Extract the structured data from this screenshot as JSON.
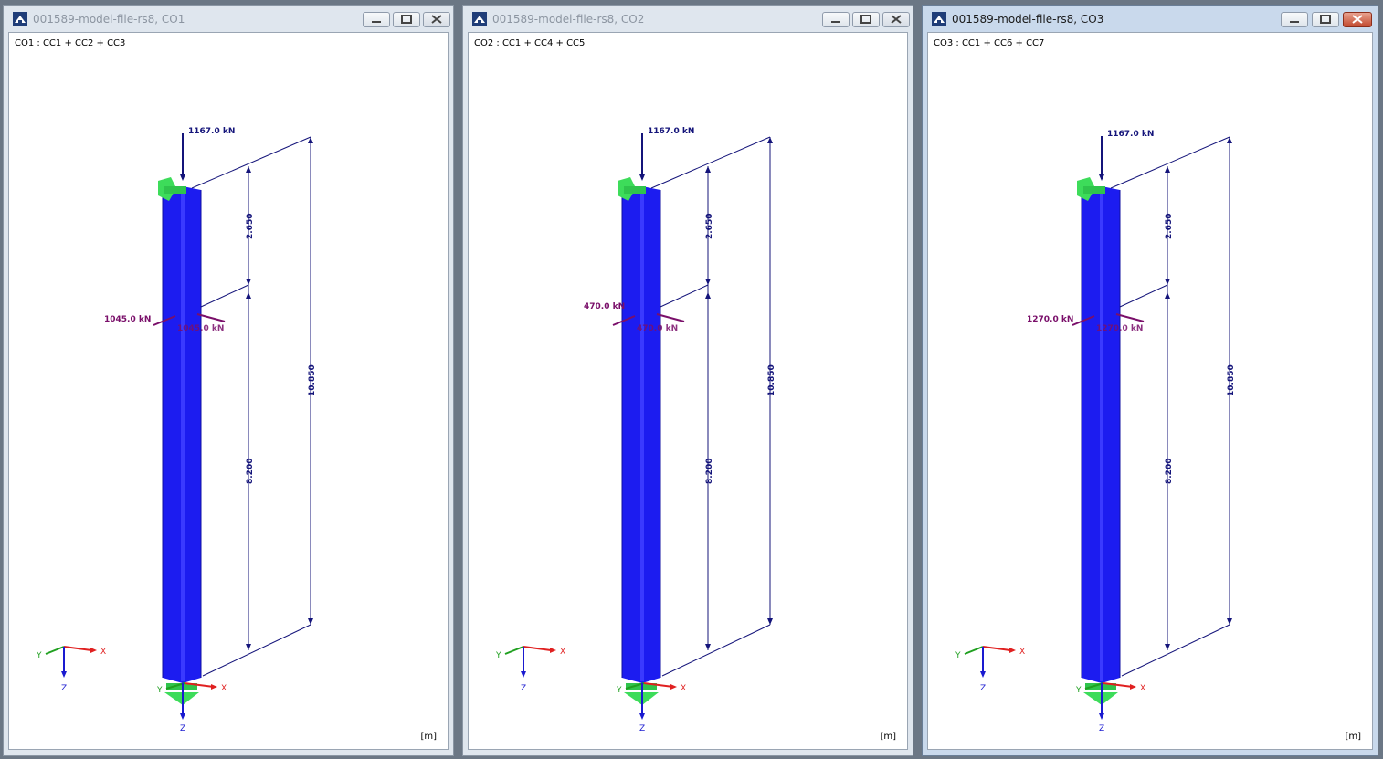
{
  "windows": [
    {
      "title": "001589-model-file-rs8, CO1",
      "active": false,
      "combination": "CO1 : CC1 + CC2 + CC3",
      "top_load": "1167.0 kN",
      "side_load_left": "1045.0 kN",
      "side_load_right": "1045.0 kN",
      "dim_upper": "2.650",
      "dim_lower": "8.200",
      "dim_total": "10.850",
      "units": "[m]"
    },
    {
      "title": "001589-model-file-rs8, CO2",
      "active": false,
      "combination": "CO2 : CC1 + CC4 + CC5",
      "top_load": "1167.0 kN",
      "side_load_left": "470.0 kN",
      "side_load_right": "470.0 kN",
      "dim_upper": "2.650",
      "dim_lower": "8.200",
      "dim_total": "10.850",
      "units": "[m]"
    },
    {
      "title": "001589-model-file-rs8, CO3",
      "active": true,
      "combination": "CO3 : CC1 + CC6 + CC7",
      "top_load": "1167.0 kN",
      "side_load_left": "1270.0 kN",
      "side_load_right": "1270.0 kN",
      "dim_upper": "2.650",
      "dim_lower": "8.200",
      "dim_total": "10.850",
      "units": "[m]"
    }
  ],
  "axes": {
    "x": "X",
    "y": "Y",
    "z": "Z"
  },
  "colors": {
    "column": "#1c1cf0",
    "load": "#14147a",
    "side_load": "#7a0f6a",
    "dimension": "#14147a",
    "support": "#3ddc5a",
    "axis_x": "#e02020",
    "axis_y": "#20a020",
    "axis_z": "#1a1ad0"
  },
  "icons": [
    "rfem-app-icon",
    "minimize-icon",
    "maximize-icon",
    "close-icon"
  ]
}
